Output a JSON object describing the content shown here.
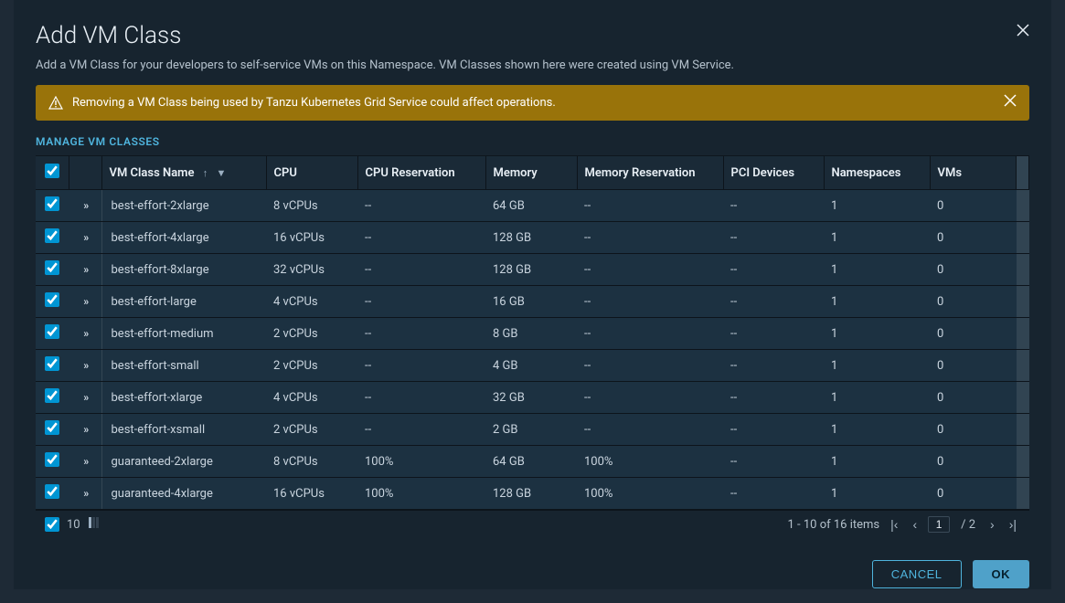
{
  "modal": {
    "title": "Add VM Class",
    "description": "Add a VM Class for your developers to self-service VMs on this Namespace. VM Classes shown here were created using VM Service.",
    "warning": "Removing a VM Class being used by Tanzu Kubernetes Grid Service could affect operations.",
    "manage_link": "MANAGE VM CLASSES"
  },
  "table": {
    "headers": {
      "name": "VM Class Name",
      "cpu": "CPU",
      "cpu_res": "CPU Reservation",
      "memory": "Memory",
      "mem_res": "Memory Reservation",
      "pci": "PCI Devices",
      "namespaces": "Namespaces",
      "vms": "VMs"
    },
    "rows": [
      {
        "checked": true,
        "name": "best-effort-2xlarge",
        "cpu": "8 vCPUs",
        "cpu_res": "--",
        "memory": "64 GB",
        "mem_res": "--",
        "pci": "--",
        "namespaces": "1",
        "vms": "0"
      },
      {
        "checked": true,
        "name": "best-effort-4xlarge",
        "cpu": "16 vCPUs",
        "cpu_res": "--",
        "memory": "128 GB",
        "mem_res": "--",
        "pci": "--",
        "namespaces": "1",
        "vms": "0"
      },
      {
        "checked": true,
        "name": "best-effort-8xlarge",
        "cpu": "32 vCPUs",
        "cpu_res": "--",
        "memory": "128 GB",
        "mem_res": "--",
        "pci": "--",
        "namespaces": "1",
        "vms": "0"
      },
      {
        "checked": true,
        "name": "best-effort-large",
        "cpu": "4 vCPUs",
        "cpu_res": "--",
        "memory": "16 GB",
        "mem_res": "--",
        "pci": "--",
        "namespaces": "1",
        "vms": "0"
      },
      {
        "checked": true,
        "name": "best-effort-medium",
        "cpu": "2 vCPUs",
        "cpu_res": "--",
        "memory": "8 GB",
        "mem_res": "--",
        "pci": "--",
        "namespaces": "1",
        "vms": "0"
      },
      {
        "checked": true,
        "name": "best-effort-small",
        "cpu": "2 vCPUs",
        "cpu_res": "--",
        "memory": "4 GB",
        "mem_res": "--",
        "pci": "--",
        "namespaces": "1",
        "vms": "0"
      },
      {
        "checked": true,
        "name": "best-effort-xlarge",
        "cpu": "4 vCPUs",
        "cpu_res": "--",
        "memory": "32 GB",
        "mem_res": "--",
        "pci": "--",
        "namespaces": "1",
        "vms": "0"
      },
      {
        "checked": true,
        "name": "best-effort-xsmall",
        "cpu": "2 vCPUs",
        "cpu_res": "--",
        "memory": "2 GB",
        "mem_res": "--",
        "pci": "--",
        "namespaces": "1",
        "vms": "0"
      },
      {
        "checked": true,
        "name": "guaranteed-2xlarge",
        "cpu": "8 vCPUs",
        "cpu_res": "100%",
        "memory": "64 GB",
        "mem_res": "100%",
        "pci": "--",
        "namespaces": "1",
        "vms": "0"
      },
      {
        "checked": true,
        "name": "guaranteed-4xlarge",
        "cpu": "16 vCPUs",
        "cpu_res": "100%",
        "memory": "128 GB",
        "mem_res": "100%",
        "pci": "--",
        "namespaces": "1",
        "vms": "0"
      }
    ],
    "footer": {
      "selected_count": "10",
      "range_text": "1 - 10 of 16 items",
      "page_current": "1",
      "page_total": "/ 2"
    }
  },
  "actions": {
    "cancel": "CANCEL",
    "ok": "OK"
  }
}
